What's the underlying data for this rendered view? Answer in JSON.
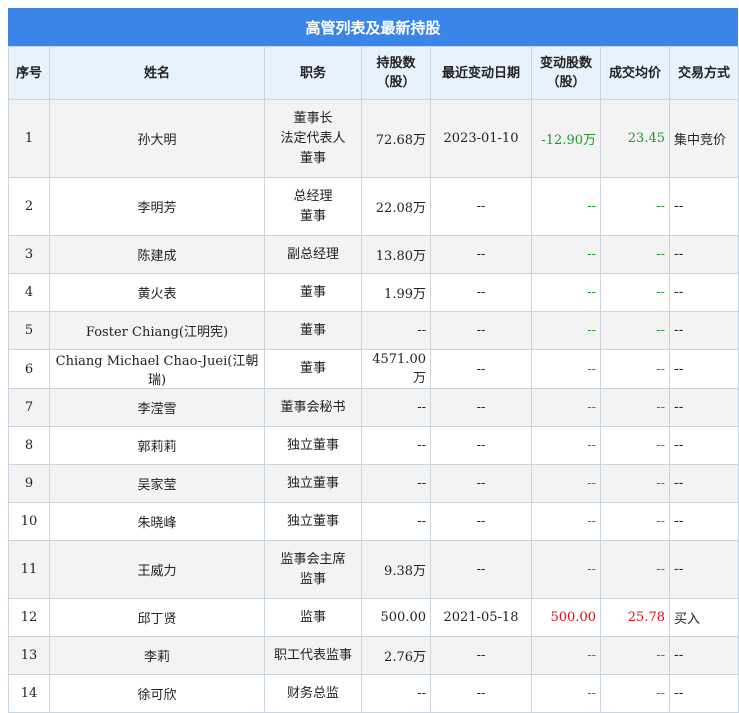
{
  "title": "高管列表及最新持股",
  "headers": {
    "seq": "序号",
    "name": "姓名",
    "position": "职务",
    "shares": "持股数（股）",
    "date": "最近变动日期",
    "change": "变动股数（股）",
    "price": "成交均价",
    "type": "交易方式"
  },
  "rows": [
    {
      "seq": "1",
      "name": "孙大明",
      "position": [
        "董事长",
        "法定代表人",
        "董事"
      ],
      "shares": "72.68万",
      "date": "2023-01-10",
      "change": "-12.90万",
      "price": "23.45",
      "type": "集中竞价"
    },
    {
      "seq": "2",
      "name": "李明芳",
      "position": [
        "总经理",
        "董事"
      ],
      "shares": "22.08万",
      "date": "--",
      "change": "--",
      "price": "--",
      "type": "--"
    },
    {
      "seq": "3",
      "name": "陈建成",
      "position": [
        "副总经理"
      ],
      "shares": "13.80万",
      "date": "--",
      "change": "--",
      "price": "--",
      "type": "--"
    },
    {
      "seq": "4",
      "name": "黄火表",
      "position": [
        "董事"
      ],
      "shares": "1.99万",
      "date": "--",
      "change": "--",
      "price": "--",
      "type": "--"
    },
    {
      "seq": "5",
      "name": "Foster Chiang(江明宪)",
      "position": [
        "董事"
      ],
      "shares": "--",
      "date": "--",
      "change": "--",
      "price": "--",
      "type": "--"
    },
    {
      "seq": "6",
      "name": "Chiang Michael Chao-Juei(江朝瑞)",
      "position": [
        "董事"
      ],
      "shares": "4571.00万",
      "date": "--",
      "change": "--",
      "price": "--",
      "type": "--"
    },
    {
      "seq": "7",
      "name": "李滢雪",
      "position": [
        "董事会秘书"
      ],
      "shares": "--",
      "date": "--",
      "change": "--",
      "price": "--",
      "type": "--"
    },
    {
      "seq": "8",
      "name": "郭莉莉",
      "position": [
        "独立董事"
      ],
      "shares": "--",
      "date": "--",
      "change": "--",
      "price": "--",
      "type": "--"
    },
    {
      "seq": "9",
      "name": "吴家莹",
      "position": [
        "独立董事"
      ],
      "shares": "--",
      "date": "--",
      "change": "--",
      "price": "--",
      "type": "--"
    },
    {
      "seq": "10",
      "name": "朱晓峰",
      "position": [
        "独立董事"
      ],
      "shares": "--",
      "date": "--",
      "change": "--",
      "price": "--",
      "type": "--"
    },
    {
      "seq": "11",
      "name": "王威力",
      "position": [
        "监事会主席",
        "监事"
      ],
      "shares": "9.38万",
      "date": "--",
      "change": "--",
      "price": "--",
      "type": "--"
    },
    {
      "seq": "12",
      "name": "邱丁贤",
      "position": [
        "监事"
      ],
      "shares": "500.00",
      "date": "2021-05-18",
      "change": "500.00",
      "price": "25.78",
      "type": "买入"
    },
    {
      "seq": "13",
      "name": "李莉",
      "position": [
        "职工代表监事"
      ],
      "shares": "2.76万",
      "date": "--",
      "change": "--",
      "price": "--",
      "type": "--"
    },
    {
      "seq": "14",
      "name": "徐可欣",
      "position": [
        "财务总监"
      ],
      "shares": "--",
      "date": "--",
      "change": "--",
      "price": "--",
      "type": "--"
    }
  ],
  "colors": {
    "header_bg": "#3a86e8",
    "negative": "#1a9a2e",
    "positive": "#d4111b"
  }
}
